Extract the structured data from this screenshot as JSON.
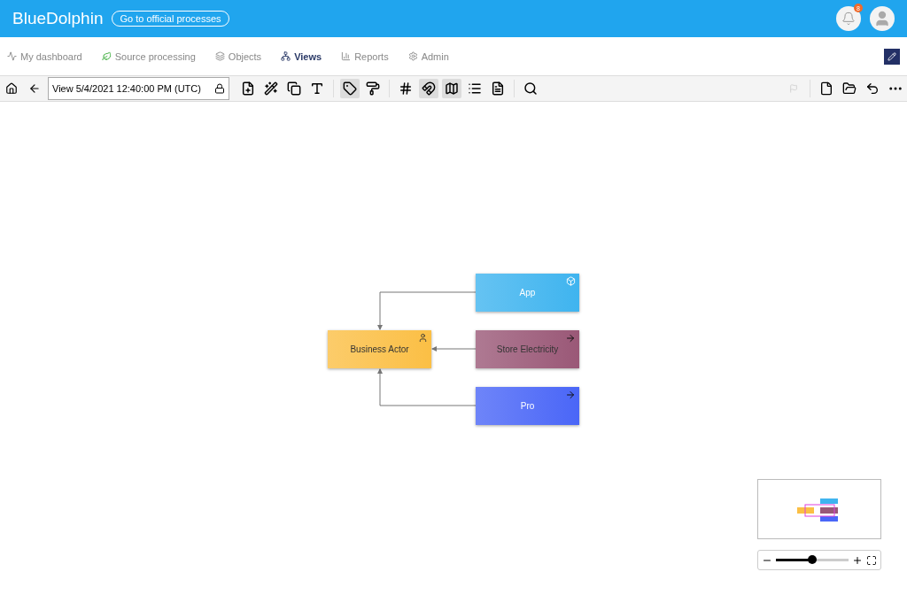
{
  "header": {
    "brand": "BlueDolphin",
    "link": "Go to official processes",
    "notifications": "8"
  },
  "nav": [
    {
      "label": "My dashboard",
      "kind": "pulse",
      "selected": false
    },
    {
      "label": "Source processing",
      "kind": "source",
      "selected": false
    },
    {
      "label": "Objects",
      "kind": "objects",
      "selected": false
    },
    {
      "label": "Views",
      "kind": "views",
      "selected": true
    },
    {
      "label": "Reports",
      "kind": "reports",
      "selected": false
    },
    {
      "label": "Admin",
      "kind": "admin",
      "selected": false
    }
  ],
  "toolbar": {
    "view_name": "View 5/4/2021 12:40:00 PM (UTC)",
    "tools": [
      {
        "kind": "add",
        "pressed": false
      },
      {
        "kind": "wand",
        "pressed": false
      },
      {
        "kind": "copy",
        "pressed": false
      },
      {
        "kind": "text",
        "pressed": false
      },
      {
        "kind": "tag",
        "pressed": true
      },
      {
        "kind": "paint",
        "pressed": false
      },
      {
        "kind": "grid",
        "pressed": false
      },
      {
        "kind": "magnet",
        "pressed": true
      },
      {
        "kind": "map",
        "pressed": true
      },
      {
        "kind": "list",
        "pressed": false
      },
      {
        "kind": "doc",
        "pressed": false
      },
      {
        "kind": "search",
        "pressed": false
      }
    ]
  },
  "diagram": {
    "nodes": [
      {
        "label": "App",
        "kind": "application",
        "color": "#3fb4ef"
      },
      {
        "label": "Business Actor",
        "kind": "actor",
        "color": "#fbbf45"
      },
      {
        "label": "Store Electricity",
        "kind": "process",
        "color": "#9a5877"
      },
      {
        "label": "Pro",
        "kind": "process",
        "color": "#4a66f7"
      }
    ]
  },
  "zoom": {
    "level": 0.5
  }
}
